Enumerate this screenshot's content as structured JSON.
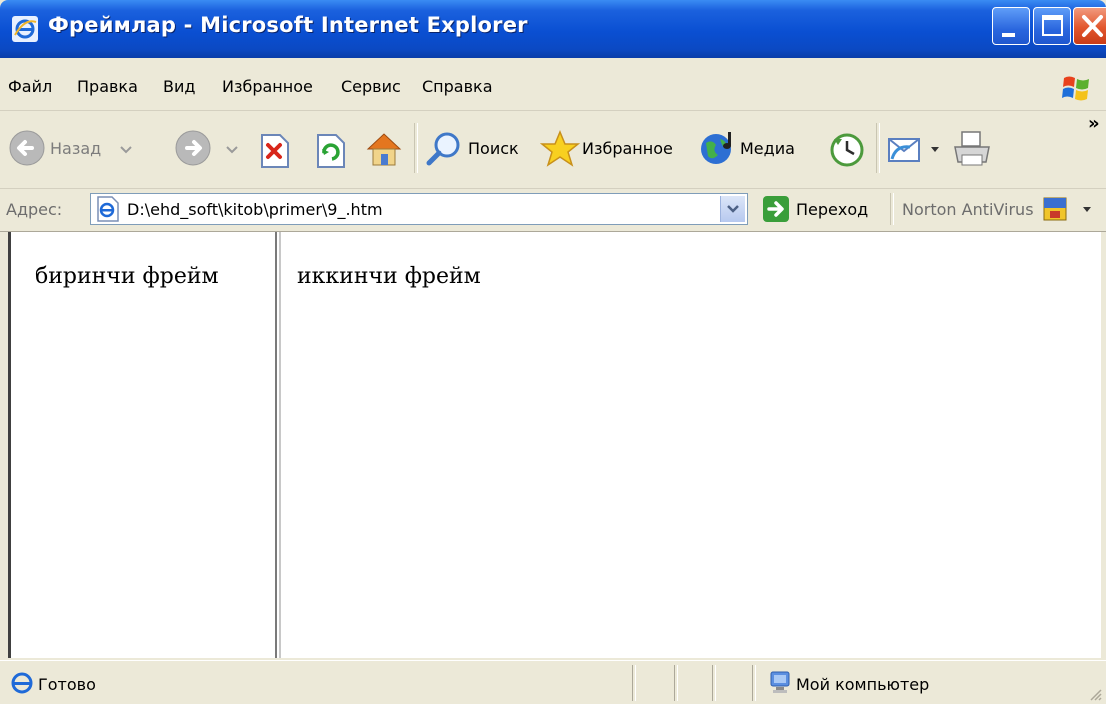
{
  "window": {
    "title": "Фреймлар - Microsoft Internet Explorer"
  },
  "menu": {
    "items": [
      "Файл",
      "Правка",
      "Вид",
      "Избранное",
      "Сервис",
      "Справка"
    ]
  },
  "toolbar": {
    "back_label": "Назад",
    "search_label": "Поиск",
    "favorites_label": "Избранное",
    "media_label": "Медиа",
    "overflow_glyph": "»"
  },
  "address": {
    "label": "Адрес:",
    "value": "D:\\ehd_soft\\kitob\\primer\\9_.htm",
    "go_label": "Переход",
    "norton_label": "Norton AntiVirus"
  },
  "frames": {
    "left_text": "биринчи фрейм",
    "right_text": "иккинчи фрейм"
  },
  "status": {
    "text": "Готово",
    "zone": "Мой компьютер"
  },
  "colors": {
    "titlebar": "#0a4fd2",
    "chrome": "#ece9d8",
    "close_button": "#e2562d"
  }
}
